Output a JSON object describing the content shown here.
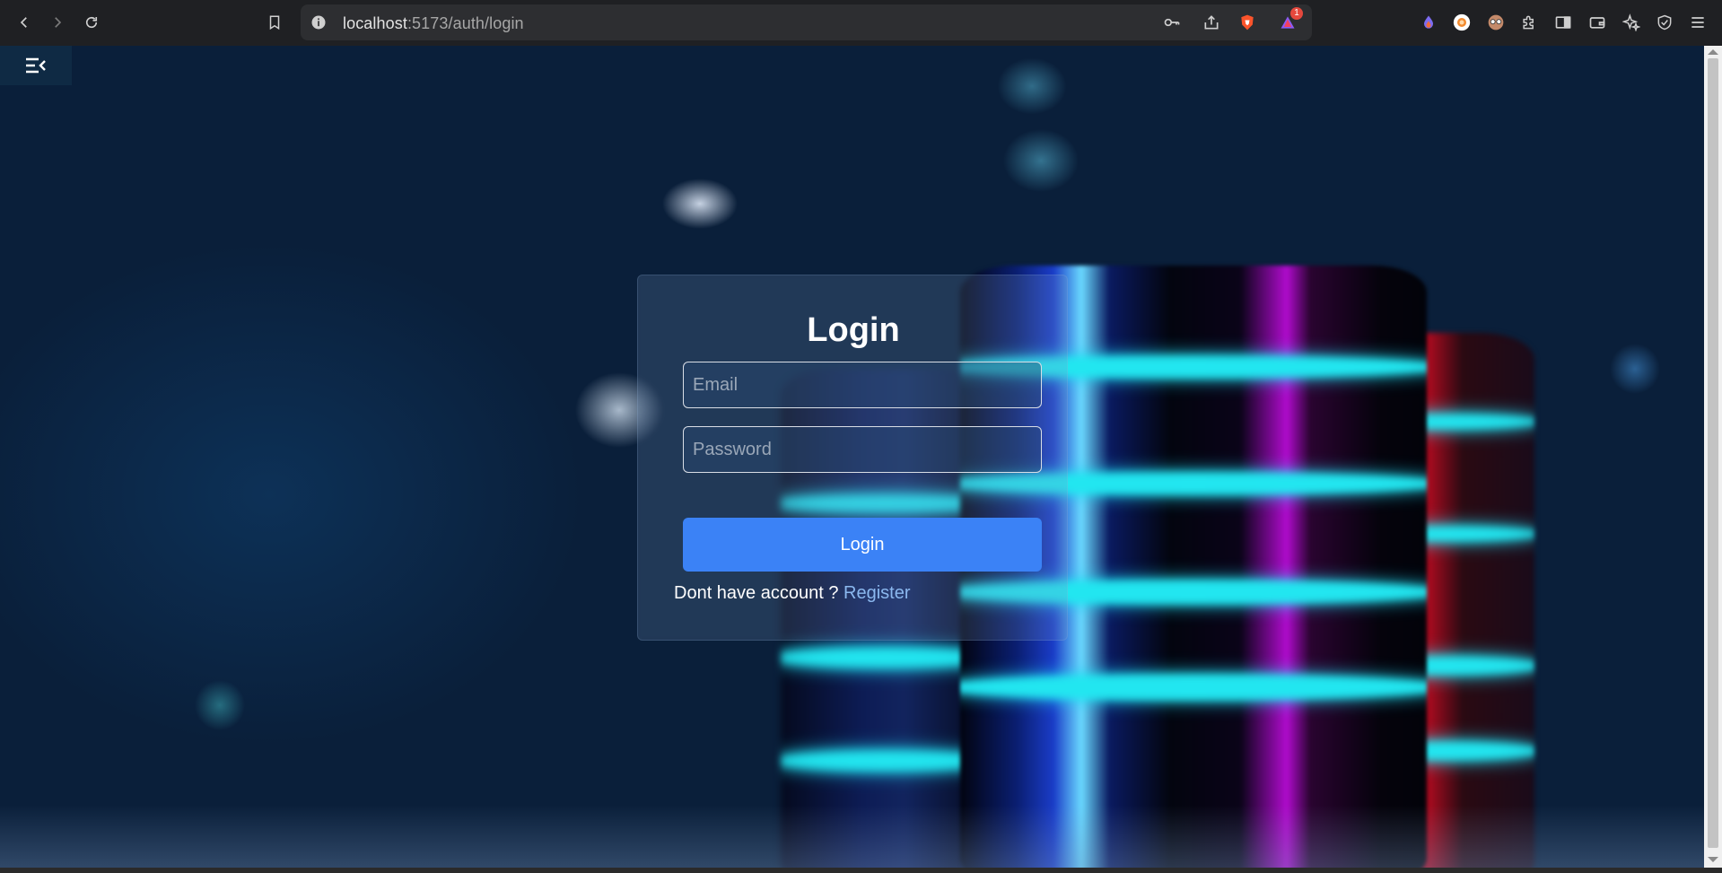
{
  "browser": {
    "url_host": "localhost",
    "url_path": ":5173/auth/login",
    "notification_count": "1",
    "icons": [
      "back-icon",
      "forward-icon",
      "reload-icon",
      "bookmark-icon",
      "site-info-icon",
      "key-icon",
      "share-icon",
      "brave-shields-icon",
      "brave-rewards-icon",
      "extension-drop-icon",
      "extension-avatar-icon",
      "extension-glasses-icon",
      "extensions-puzzle-icon",
      "sidebar-icon",
      "wallet-icon",
      "leo-ai-icon",
      "vpn-icon",
      "menu-icon"
    ]
  },
  "sidebar": {
    "toggle_icon": "menu-collapse-icon"
  },
  "login": {
    "title": "Login",
    "email_placeholder": "Email",
    "password_placeholder": "Password",
    "submit_label": "Login",
    "register_prompt": "Dont have account ?",
    "register_link": "Register"
  },
  "colors": {
    "primary_button": "#3b82f6",
    "register_link": "#8bb8ef",
    "neon_cyan": "#22e6f0"
  }
}
